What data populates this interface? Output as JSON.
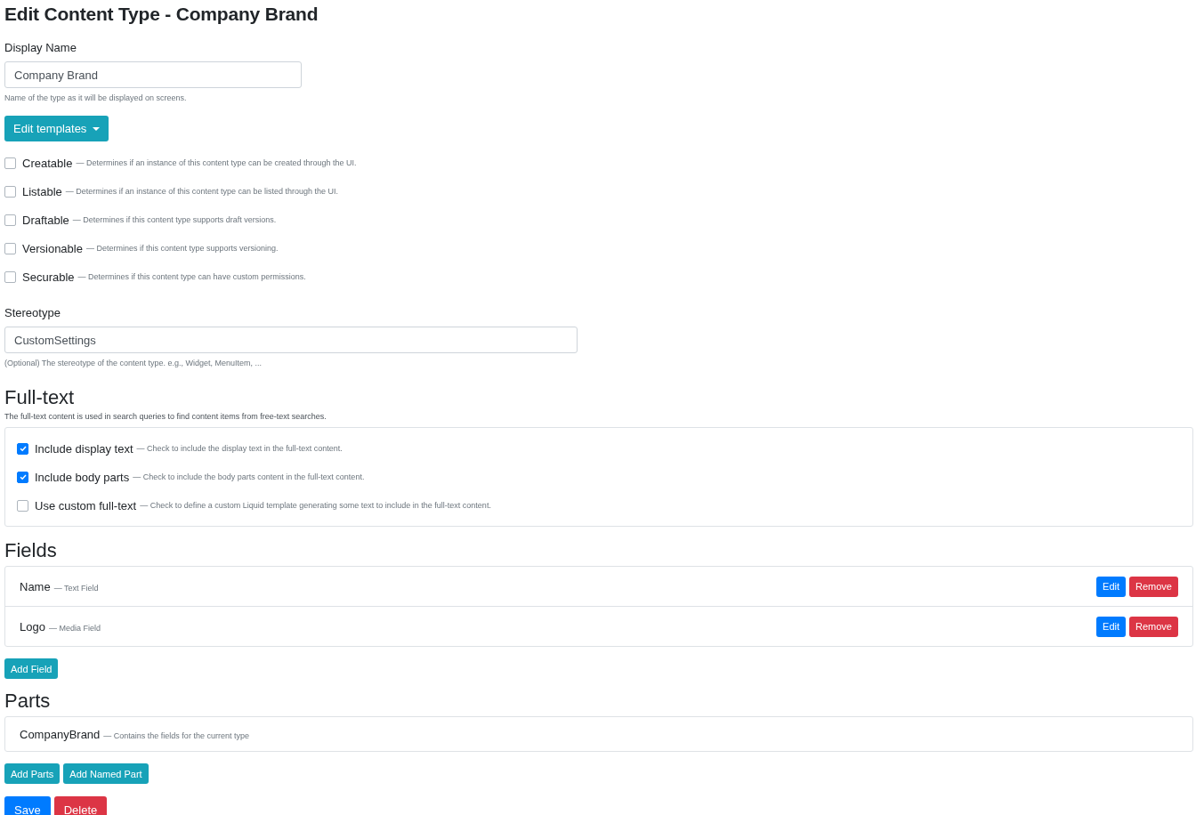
{
  "title": "Edit Content Type - Company Brand",
  "display_name": {
    "label": "Display Name",
    "value": "Company Brand",
    "hint": "Name of the type as it will be displayed on screens."
  },
  "templates_button": {
    "label": "Edit templates"
  },
  "options": [
    {
      "label": "Creatable",
      "description": "— Determines if an instance of this content type can be created through the UI.",
      "checked": false
    },
    {
      "label": "Listable",
      "description": "— Determines if an instance of this content type can be listed through the UI.",
      "checked": false
    },
    {
      "label": "Draftable",
      "description": "— Determines if this content type supports draft versions.",
      "checked": false
    },
    {
      "label": "Versionable",
      "description": "— Determines if this content type supports versioning.",
      "checked": false
    },
    {
      "label": "Securable",
      "description": "— Determines if this content type can have custom permissions.",
      "checked": false
    }
  ],
  "stereotype": {
    "label": "Stereotype",
    "value": "CustomSettings",
    "hint": "(Optional) The stereotype of the content type. e.g., Widget, MenuItem, ..."
  },
  "full_text": {
    "heading": "Full-text",
    "description": "The full-text content is used in search queries to find content items from free-text searches.",
    "options": [
      {
        "label": "Include display text",
        "description": "— Check to include the display text in the full-text content.",
        "checked": true
      },
      {
        "label": "Include body parts",
        "description": "— Check to include the body parts content in the full-text content.",
        "checked": true
      },
      {
        "label": "Use custom full-text",
        "description": "— Check to define a custom Liquid template generating some text to include in the full-text content.",
        "checked": false
      }
    ]
  },
  "fields": {
    "heading": "Fields",
    "items": [
      {
        "name": "Name",
        "type": "— Text Field",
        "edit": "Edit",
        "remove": "Remove"
      },
      {
        "name": "Logo",
        "type": "— Media Field",
        "edit": "Edit",
        "remove": "Remove"
      }
    ],
    "add_button": "Add Field"
  },
  "parts": {
    "heading": "Parts",
    "items": [
      {
        "name": "CompanyBrand",
        "description": "— Contains the fields for the current type"
      }
    ],
    "buttons": [
      "Add Parts",
      "Add Named Part"
    ]
  },
  "actions": [
    {
      "label": "Save",
      "kind": "primary"
    },
    {
      "label": "Delete",
      "kind": "danger"
    }
  ]
}
